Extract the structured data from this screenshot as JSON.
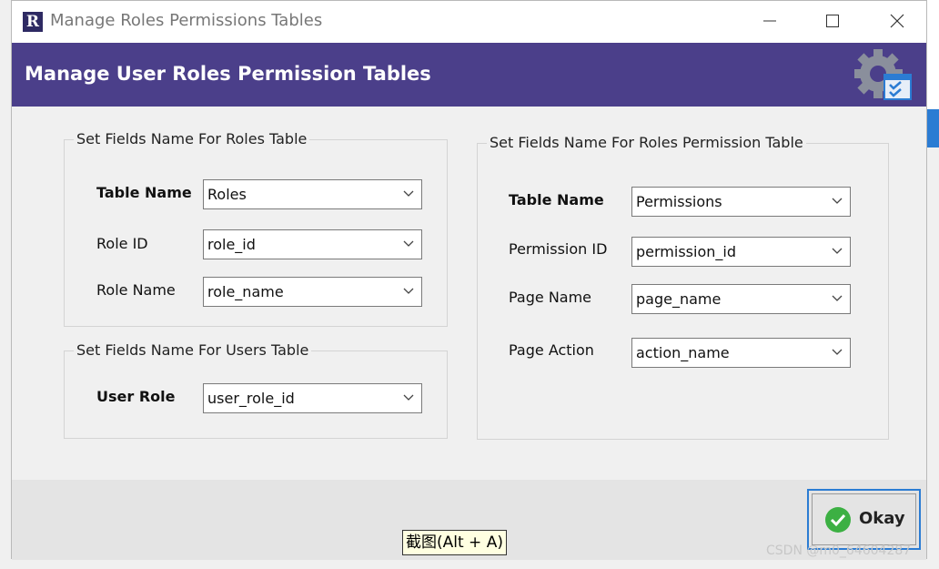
{
  "window": {
    "title": "Manage Roles Permissions Tables",
    "app_icon_letter": "R"
  },
  "banner": {
    "title": "Manage User Roles Permission Tables"
  },
  "roles_group": {
    "legend": "Set Fields Name For Roles Table",
    "fields": [
      {
        "label": "Table Name",
        "value": "Roles"
      },
      {
        "label": "Role ID",
        "value": "role_id"
      },
      {
        "label": "Role Name",
        "value": "role_name"
      }
    ]
  },
  "users_group": {
    "legend": "Set Fields Name For Users Table",
    "fields": [
      {
        "label": "User Role",
        "value": "user_role_id"
      }
    ]
  },
  "permission_group": {
    "legend": "Set Fields Name For Roles Permission Table",
    "fields": [
      {
        "label": "Table Name",
        "value": "Permissions"
      },
      {
        "label": "Permission ID",
        "value": "permission_id"
      },
      {
        "label": "Page Name",
        "value": "page_name"
      },
      {
        "label": "Page Action",
        "value": "action_name"
      }
    ]
  },
  "okay_button": {
    "label": "Okay"
  },
  "tooltip": {
    "text": "截图(Alt + A)"
  },
  "watermark": {
    "text": "CSDN @m0_64604287"
  },
  "colors": {
    "banner": "#4b3f8a",
    "focus_border": "#2b7cd3",
    "ok_check": "#3cb043"
  }
}
